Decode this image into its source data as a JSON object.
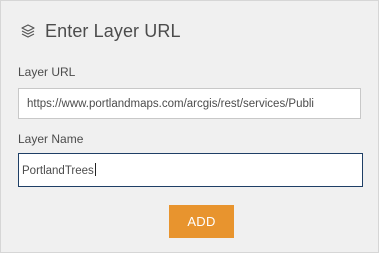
{
  "header": {
    "icon": "layers-icon",
    "title": "Enter Layer URL"
  },
  "form": {
    "url_label": "Layer URL",
    "url_value": "https://www.portlandmaps.com/arcgis/rest/services/Publi",
    "name_label": "Layer Name",
    "name_value": "PortlandTrees"
  },
  "actions": {
    "add_label": "ADD"
  },
  "colors": {
    "panel_bg": "#f0f0f0",
    "button_accent": "#e8942e",
    "focus_border": "#1f3f66"
  }
}
